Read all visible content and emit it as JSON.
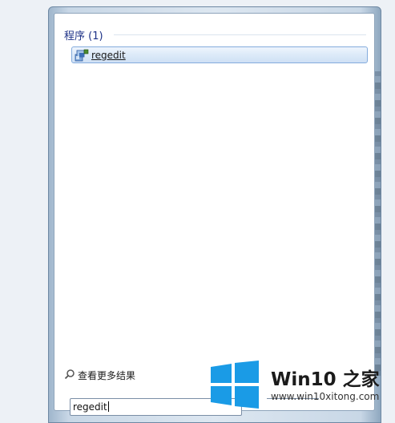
{
  "start_menu": {
    "group_header": "程序 (1)",
    "results": [
      {
        "label": "regedit",
        "icon": "registry-editor-icon"
      }
    ],
    "more_results_label": "查看更多结果",
    "search": {
      "value": "regedit"
    }
  },
  "watermark": {
    "brand": "Win10 之家",
    "url": "www.win10xitong.com"
  },
  "colors": {
    "header_text": "#1e3287",
    "selection_border": "#84acdd",
    "windows_logo": "#1a9be6",
    "brand_accent": "#2f7fd6"
  }
}
